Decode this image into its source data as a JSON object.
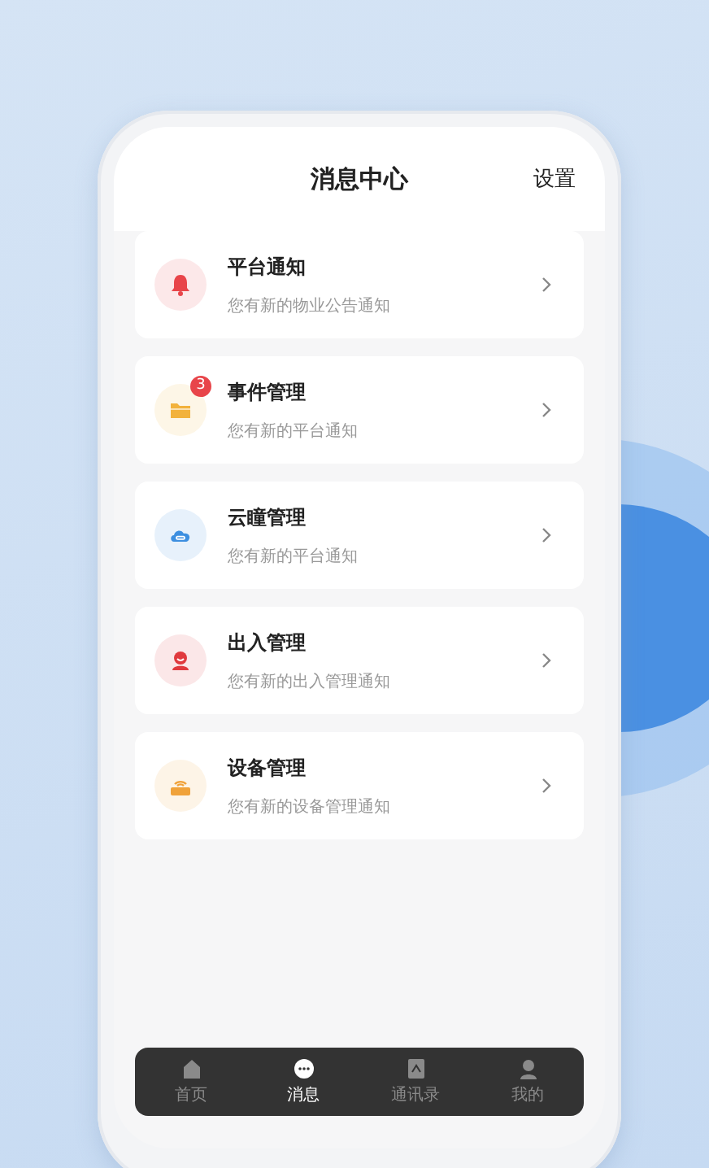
{
  "header": {
    "title": "消息中心",
    "action": "设置"
  },
  "messages": [
    {
      "title": "平台通知",
      "subtitle": "您有新的物业公告通知",
      "kind": "bell",
      "color": "#e8454a"
    },
    {
      "title": "事件管理",
      "subtitle": "您有新的平台通知",
      "kind": "folder",
      "color": "#f2b23c",
      "badge": "3"
    },
    {
      "title": "云瞳管理",
      "subtitle": "您有新的平台通知",
      "kind": "cloud",
      "color": "#3d8fe0"
    },
    {
      "title": "出入管理",
      "subtitle": "您有新的出入管理通知",
      "kind": "person",
      "color": "#e03a3e"
    },
    {
      "title": "设备管理",
      "subtitle": "您有新的设备管理通知",
      "kind": "router",
      "color": "#f0a23a"
    }
  ],
  "tab_bar": [
    {
      "label": "首页",
      "kind": "home",
      "selected": false
    },
    {
      "label": "消息",
      "kind": "chat",
      "selected": true
    },
    {
      "label": "通讯录",
      "kind": "contacts",
      "selected": false
    },
    {
      "label": "我的",
      "kind": "user",
      "selected": false
    }
  ]
}
